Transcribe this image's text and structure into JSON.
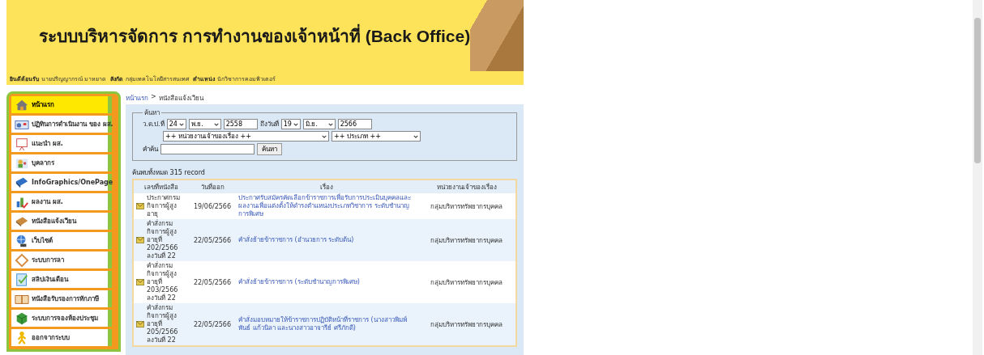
{
  "header": {
    "title": "ระบบบริหารจัดการ การทำงานของเจ้าหน้าที่ (Back Office)"
  },
  "user_bar": [
    {
      "label": "ยินดีต้อนรับ",
      "value": "นายปริญญากรณ์ มาหยาด"
    },
    {
      "label": "สังกัด",
      "value": "กลุ่มเทคโนโลยีสารสนเทศ"
    },
    {
      "label": "ตำแหน่ง",
      "value": "นักวิชาการคอมพิวเตอร์"
    }
  ],
  "sidebar": {
    "items": [
      {
        "label": "หน้าแรก",
        "selected": true
      },
      {
        "label": "ปฏิทินการดำเนินงาน ของ ผส.",
        "selected": false
      },
      {
        "label": "แนะนำ ผส.",
        "selected": false
      },
      {
        "label": "บุคลากร",
        "selected": false
      },
      {
        "label": "InfoGraphics/OnePage",
        "selected": false
      },
      {
        "label": "ผลงาน ผส.",
        "selected": false
      },
      {
        "label": "หนังสือแจ้งเวียน",
        "selected": false
      },
      {
        "label": "เว็บไซต์",
        "selected": false
      },
      {
        "label": "ระบบการลา",
        "selected": false
      },
      {
        "label": "สลิปเงินเดือน",
        "selected": false
      },
      {
        "label": "หนังสือรับรองการหักภาษี",
        "selected": false
      },
      {
        "label": "ระบบการจองห้องประชุม",
        "selected": false
      },
      {
        "label": "ออกจากระบบ",
        "selected": false
      }
    ]
  },
  "breadcrumb": [
    "หน้าแรก",
    "หนังสือแจ้งเวียน"
  ],
  "breadcrumb_separator": ">",
  "search": {
    "legend": "ค้นหา",
    "from_label": "ว.ด.ป.ที่",
    "from_day": "24",
    "from_month": "พ.ย.",
    "from_year": "2558",
    "to_label": "ถึงวันที่",
    "to_day": "19",
    "to_month": "มิ.ย.",
    "to_year": "2566",
    "agency": "++ หน่วยงานเจ้าของเรื่อง ++",
    "type": "++ ประเภท ++",
    "keyword_label": "คำค้น",
    "button": "ค้นหา"
  },
  "result_count": "ค้นพบทั้งหมด 315 record",
  "table": {
    "columns": [
      "เลขที่หนังสือ",
      "วันที่ออก",
      "เรื่อง",
      "หน่วยงานเจ้าของเรื่อง"
    ],
    "rows": [
      {
        "number": "ประกาศกรมกิจการผู้สูงอายุ",
        "date": "19/06/2566",
        "subject": "ประกาศรับสมัครคัดเลือกข้าราชการเพื่อรับการประเมินบุคคลและผลงานเพื่อแต่งตั้งให้ดำรงตำแหน่งประเภทวิชาการ ระดับชำนาญการพิเศษ",
        "agency": "กลุ่มบริหารทรัพยากรบุคคล"
      },
      {
        "number": "คำสั่งกรมกิจการผู้สูงอายุที่ 202/2566 ลงวันที่ 22",
        "date": "22/05/2566",
        "subject": "คำสั่งย้ายข้าราชการ (อำนวยการ ระดับต้น)",
        "agency": "กลุ่มบริหารทรัพยากรบุคคล"
      },
      {
        "number": "คำสั่งกรมกิจการผู้สูงอายุที่ 203/2566 ลงวันที่ 22",
        "date": "22/05/2566",
        "subject": "คำสั่งย้ายข้าราชการ (ระดับชำนาญการพิเศษ)",
        "agency": "กลุ่มบริหารทรัพยากรบุคคล"
      },
      {
        "number": "คำสั่งกรมกิจการผู้สูงอายุที่ 205/2566 ลงวันที่ 22",
        "date": "22/05/2566",
        "subject": "คำสั่งมอบหมายให้ข้าราชการปฏิบัติหน้าที่ราชการ (นางสาวพิมพ์พันธ์ แก้วนิลา และนางสาวอาจารีย์ ศรีภักดี)",
        "agency": "กลุ่มบริหารทรัพยากรบุคคล"
      }
    ]
  }
}
